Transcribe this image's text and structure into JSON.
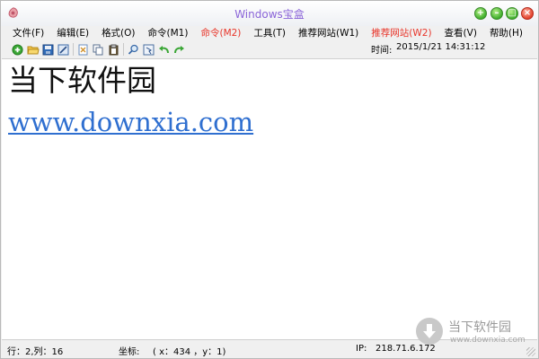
{
  "window": {
    "title": "Windows宝盒"
  },
  "menu": [
    {
      "label": "文件(F)",
      "highlight": false
    },
    {
      "label": "编辑(E)",
      "highlight": false
    },
    {
      "label": "格式(O)",
      "highlight": false
    },
    {
      "label": "命令(M1)",
      "highlight": false
    },
    {
      "label": "命令(M2)",
      "highlight": true
    },
    {
      "label": "工具(T)",
      "highlight": false
    },
    {
      "label": "推荐网站(W1)",
      "highlight": false
    },
    {
      "label": "推荐网站(W2)",
      "highlight": true
    },
    {
      "label": "查看(V)",
      "highlight": false
    },
    {
      "label": "帮助(H)",
      "highlight": false
    }
  ],
  "toolbar": {
    "icons": [
      "new-icon",
      "open-folder-icon",
      "save-icon",
      "edit-icon",
      "cut-icon",
      "copy-icon",
      "paste-icon",
      "find-icon",
      "select-icon",
      "undo-icon",
      "redo-icon"
    ],
    "time_label": "时间:",
    "time_value": "2015/1/21  14:31:12"
  },
  "editor": {
    "line1": "当下软件园",
    "line2": "www.downxia.com"
  },
  "status": {
    "row_col": "行：2,列：16",
    "coord_label": "坐标:",
    "coord_value": "( x：434 ，y：1)",
    "ip_label": "IP:",
    "ip_value": "218.71.6.172"
  },
  "watermark": {
    "brand": "当下软件园",
    "url": "www.downxia.com"
  },
  "colors": {
    "title": "#8a64d8",
    "menu_highlight": "#e8352a",
    "link": "#2f6fd0"
  }
}
